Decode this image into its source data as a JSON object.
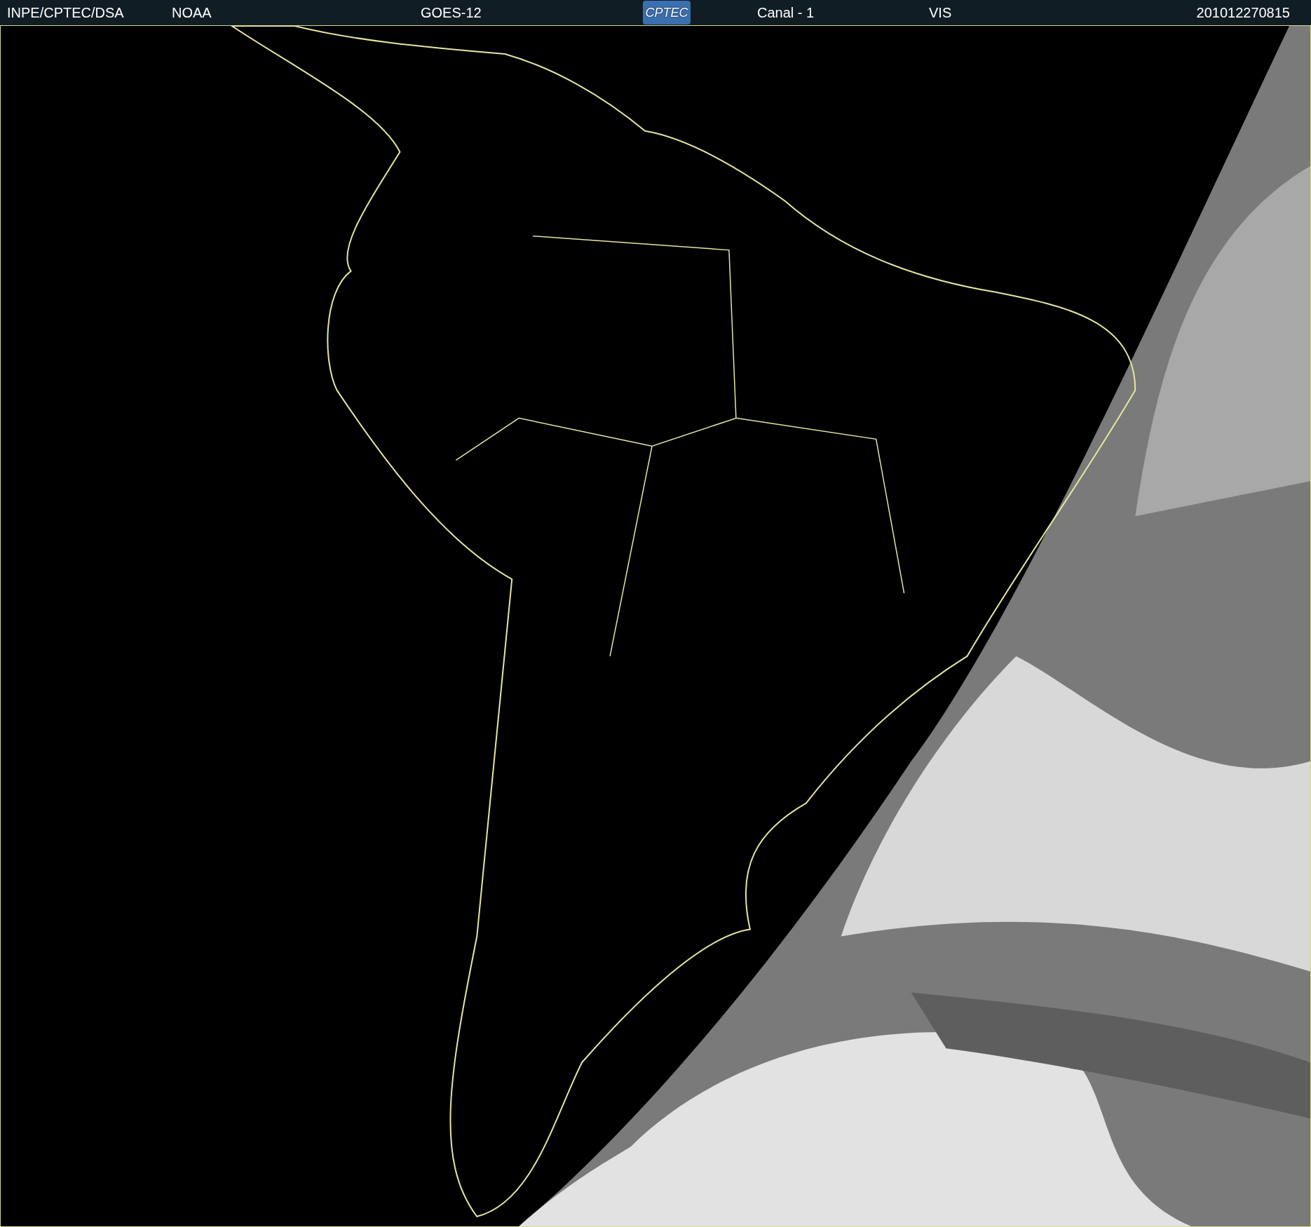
{
  "header": {
    "source": "INPE/CPTEC/DSA",
    "agency": "NOAA",
    "satellite": "GOES-12",
    "logo_text": "CPTEC",
    "channel": "Canal - 1",
    "band": "VIS",
    "timestamp": "201012270815"
  }
}
